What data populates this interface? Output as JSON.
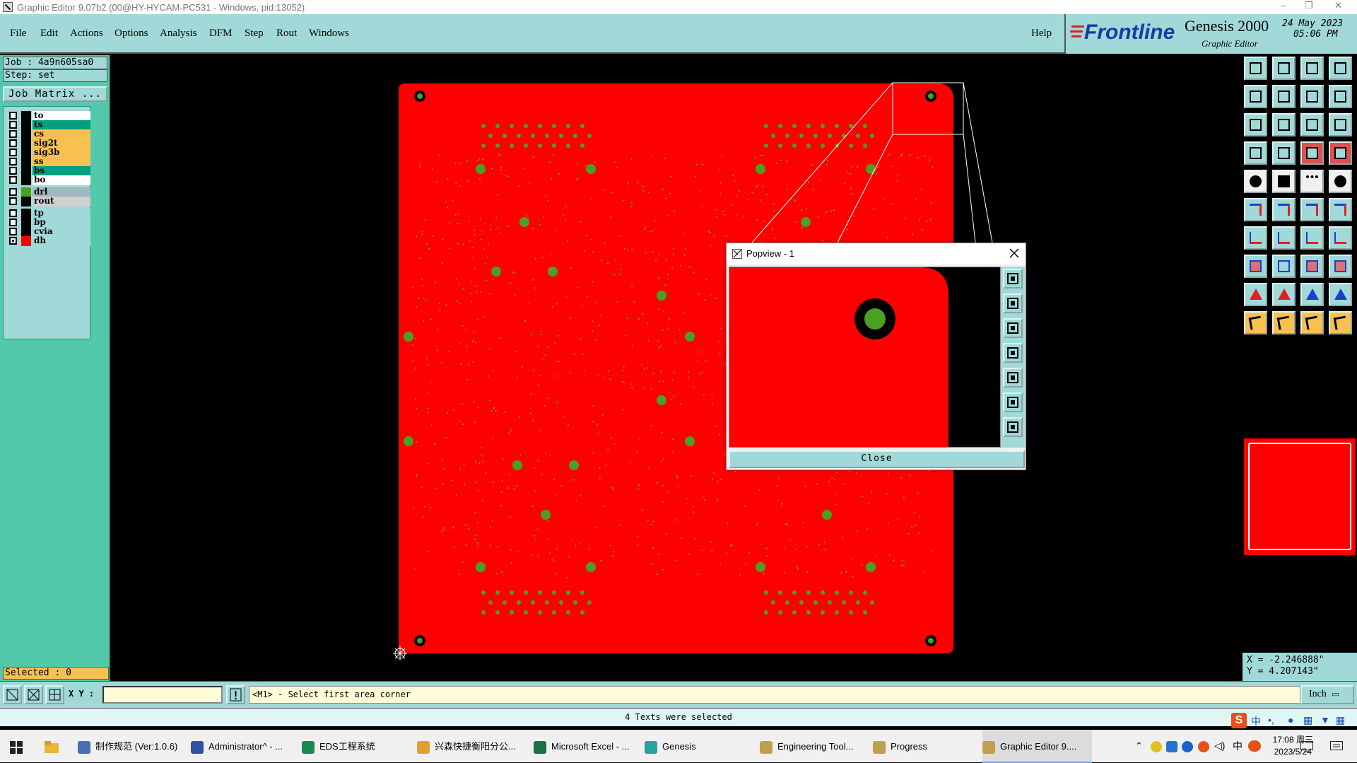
{
  "window": {
    "title": "Graphic Editor 9.07b2 (00@HY-HYCAM-PC531 - Windows, pid:13052)",
    "controls": [
      "–",
      "❐",
      "✕"
    ]
  },
  "menu": {
    "items": [
      "File",
      "Edit",
      "Actions",
      "Options",
      "Analysis",
      "DFM",
      "Step",
      "Rout",
      "Windows"
    ],
    "help": "Help"
  },
  "brand": {
    "logo": "Frontline",
    "product": "Genesis 2000",
    "subtitle": "Graphic Editor",
    "date": "24 May 2023",
    "time": "05:06 PM"
  },
  "job": {
    "job_label": "Job : 4a9n605sa0",
    "step_label": "Step: set",
    "matrix_button": "Job Matrix ..."
  },
  "layers": [
    {
      "name": "to",
      "swatch": "#ffffff",
      "bg": "#ffffff"
    },
    {
      "name": "ts",
      "swatch": "#00a080",
      "bg": "#00a080"
    },
    {
      "name": "cs",
      "swatch": "#f8c050",
      "bg": "#f8c050"
    },
    {
      "name": "sig2t",
      "swatch": "#f8c050",
      "bg": "#f8c050"
    },
    {
      "name": "sig3b",
      "swatch": "#f8c050",
      "bg": "#f8c050"
    },
    {
      "name": "ss",
      "swatch": "#f8c050",
      "bg": "#f8c050"
    },
    {
      "name": "bs",
      "swatch": "#00a080",
      "bg": "#00a080"
    },
    {
      "name": "bo",
      "swatch": "#ffffff",
      "bg": "#ffffff"
    },
    {
      "name": "drl",
      "swatch": "#4aa020",
      "bg": "#a0b8c0"
    },
    {
      "name": "rout",
      "swatch": "#d0d0d0",
      "bg": "#d0d0d0"
    },
    {
      "name": "tp",
      "swatch": "#a0d9d8",
      "bg": "#a0d9d8"
    },
    {
      "name": "bp",
      "swatch": "#a0d9d8",
      "bg": "#a0d9d8"
    },
    {
      "name": "cvia",
      "swatch": "#a0d9d8",
      "bg": "#a0d9d8"
    },
    {
      "name": "dh",
      "swatch": "#ff0000",
      "bg": "#a0d9d8"
    }
  ],
  "selected_label": "Selected : 0",
  "coords": {
    "x": "X = -2.246888\"",
    "y": "Y = 4.207143\""
  },
  "command": {
    "xy_label": "X Y :",
    "prompt": "<M1> - Select first area corner",
    "unit": "Inch"
  },
  "status": "4 Texts were selected",
  "popview": {
    "title": "Popview - 1",
    "close_label": "Close"
  },
  "taskbar": {
    "items": [
      {
        "label": "制作规范 (Ver:1.0.6)",
        "color": "#4a6fb0"
      },
      {
        "label": "Administrator^ - ...",
        "color": "#3050a0"
      },
      {
        "label": "EDS工程系统",
        "color": "#1a8a50"
      },
      {
        "label": "兴森快捷衡阳分公...",
        "color": "#e0a030"
      },
      {
        "label": "Microsoft Excel - ...",
        "color": "#1d7044"
      },
      {
        "label": "Genesis",
        "color": "#2aa0a0"
      },
      {
        "label": "Engineering Tool...",
        "color": "#c0a050"
      },
      {
        "label": "Progress",
        "color": "#c0a050"
      },
      {
        "label": "Graphic Editor 9....",
        "color": "#c0a050"
      }
    ],
    "clock_time": "17:08 周三",
    "clock_date": "2023/5/24",
    "ime": "中"
  }
}
